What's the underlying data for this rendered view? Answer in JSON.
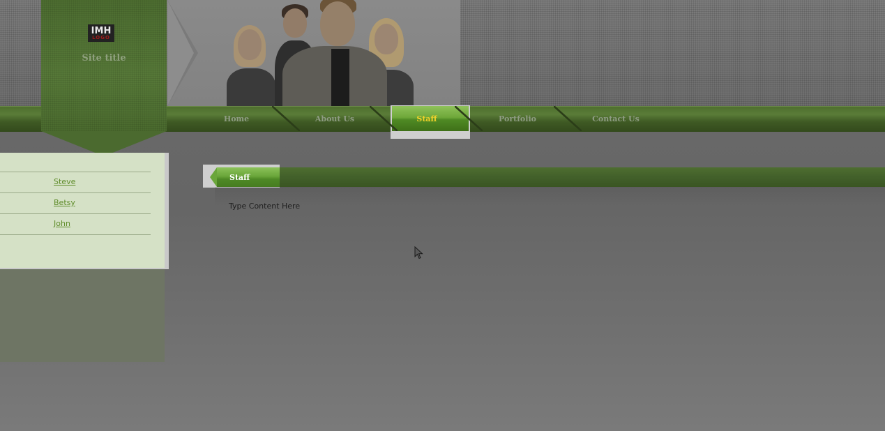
{
  "logo": {
    "line1": "IMH",
    "line2": "LOGO"
  },
  "site_title": "Site title",
  "nav": {
    "items": [
      {
        "label": "Home",
        "active": false
      },
      {
        "label": "About Us",
        "active": false
      },
      {
        "label": "Staff",
        "active": true
      },
      {
        "label": "Portfolio",
        "active": false
      },
      {
        "label": "Contact Us",
        "active": false
      }
    ]
  },
  "sidebar": {
    "links": [
      "Steve",
      "Betsy",
      "John"
    ]
  },
  "content": {
    "heading": "Staff",
    "body": "Type Content Here"
  },
  "colors": {
    "brand_green": "#4f6f33",
    "active_nav_text": "#f2d12a",
    "sidebar_bg": "#d5e1c6",
    "link": "#5f8c2a"
  }
}
